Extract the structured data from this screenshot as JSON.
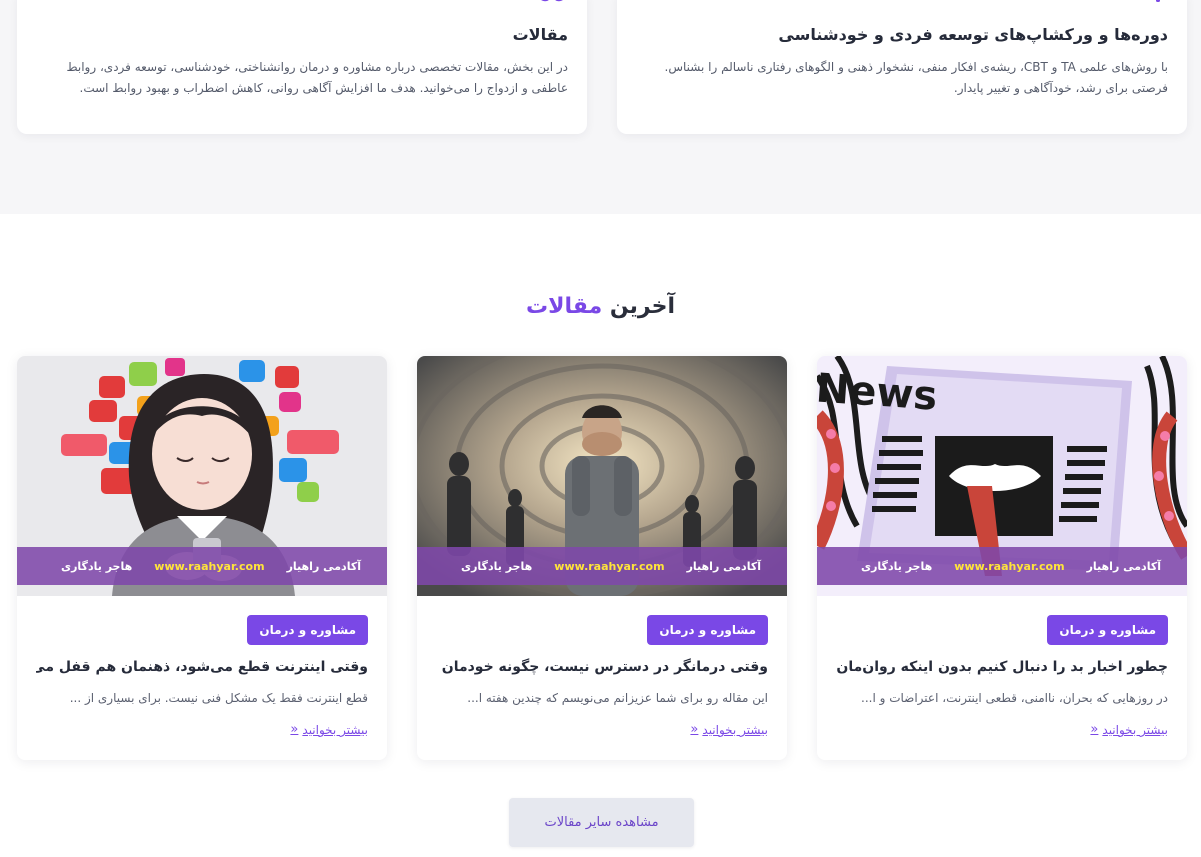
{
  "services": [
    {
      "title": "دوره‌ها و ورکشاپ‌های توسعه فردی و خودشناسی",
      "text": "با روش‌های علمی TA و CBT، ریشه‌ی افکار منفی، نشخوار ذهنی و الگوهای رفتاری ناسالم را بشناس. فرصتی برای رشد، خودآگاهی و تغییر پایدار.",
      "icon": "course-icon"
    },
    {
      "title": "مقالات",
      "text": "در این بخش، مقالات تخصصی درباره مشاوره و درمان روانشناختی، خودشناسی، توسعه فردی، روابط عاطفی و ازدواج را می‌خوانید. هدف ما افزایش آگاهی روانی، کاهش اضطراب و بهبود روابط است.",
      "icon": "articles-icon"
    }
  ],
  "latest": {
    "title_main": "آخرین",
    "title_accent": "مقالات",
    "accent_color": "#7a48e6"
  },
  "posts": [
    {
      "category": "مشاوره و درمان",
      "title": "چطور اخبار بد را دنبال کنیم بدون اینکه روان‌مان فرو...",
      "excerpt": "در روزهایی که بحران، ناامنی، قطعی اینترنت، اعتراضات و ا...",
      "read_more": "بیشتر بخوانید",
      "band_academy": "آکادمی راهیار",
      "band_site": "www.raahyar.com",
      "band_author": "هاجر یادگاری",
      "image": "news-illustration"
    },
    {
      "category": "مشاوره و درمان",
      "title": "وقتی درمانگر در دسترس نیست، چگونه خودمان را آ...",
      "excerpt": "این مقاله رو برای شما عزیزانم می‌نویسم که چندین هفته ا...",
      "read_more": "بیشتر بخوانید",
      "band_academy": "آکادمی راهیار",
      "band_site": "www.raahyar.com",
      "band_author": "هاجر یادگاری",
      "image": "distressed-man-illustration"
    },
    {
      "category": "مشاوره و درمان",
      "title": "وقتی اینترنت قطع می‌شود، ذهنمان هم قفل می‌کن...",
      "excerpt": "قطع اینترنت فقط یک مشکل فنی نیست. برای بسیاری از ...",
      "read_more": "بیشتر بخوانید",
      "band_academy": "آکادمی راهیار",
      "band_site": "www.raahyar.com",
      "band_author": "هاجر یادگاری",
      "image": "girl-phone-apps-illustration"
    }
  ],
  "more_button": "مشاهده سایر مقالات"
}
